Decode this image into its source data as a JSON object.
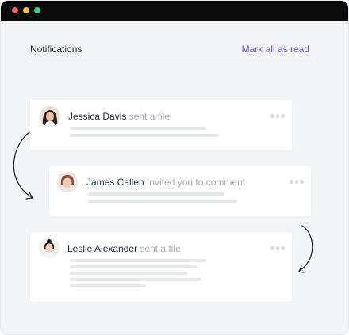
{
  "window": {
    "controls": [
      {
        "name": "close",
        "color": "#ef5f6b"
      },
      {
        "name": "minimize",
        "color": "#f6c244"
      },
      {
        "name": "maximize",
        "color": "#3ecf8e"
      }
    ]
  },
  "header": {
    "title": "Notifications",
    "mark_all_read": "Mark all as read",
    "accent_color": "#6b4fd6"
  },
  "notifications": [
    {
      "name": "Jessica Davis",
      "action": "sent a file",
      "avatar": "avatar-jessica"
    },
    {
      "name": "James Callen",
      "action": "Invited you to comment",
      "avatar": "avatar-james"
    },
    {
      "name": "Leslie Alexander",
      "action": "sent a file",
      "avatar": "avatar-leslie"
    }
  ],
  "icons": [
    "more-options-icon",
    "curved-arrow-icon"
  ]
}
